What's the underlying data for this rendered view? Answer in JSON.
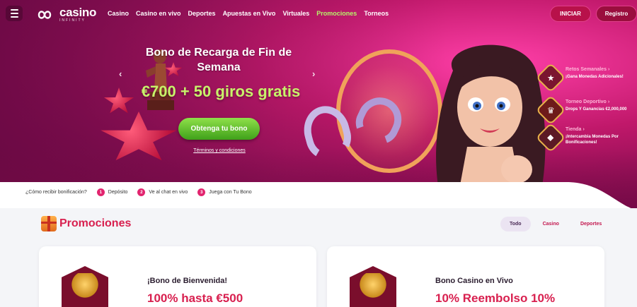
{
  "nav": {
    "logo_main": "casino",
    "logo_sub": "INFINITY",
    "links": [
      {
        "label": "Casino"
      },
      {
        "label": "Casino en vivo"
      },
      {
        "label": "Deportes"
      },
      {
        "label": "Apuestas en Vivo"
      },
      {
        "label": "Virtuales"
      },
      {
        "label": "Promociones"
      },
      {
        "label": "Torneos"
      }
    ],
    "active_link": "Promociones",
    "login_label": "INICIAR",
    "register_label": "Registro"
  },
  "banner": {
    "title": "Bono de Recarga de Fin de Semana",
    "offer": "€700 + 50 giros gratis",
    "cta_label": "Obtenga tu bono",
    "terms_label": "Términos y condiciones",
    "prev_icon": "chevron-left-icon",
    "next_icon": "chevron-right-icon"
  },
  "side_promos": [
    {
      "title": "Retos Semanales",
      "subtitle": "¡Gana Monedas Adicionales!",
      "icon": "star-badge-icon"
    },
    {
      "title": "Torneo Deportivo",
      "subtitle": "Drops Y Ganancias €2,000,000",
      "icon": "trophy-badge-icon"
    },
    {
      "title": "Tienda",
      "subtitle": "¡Intercambia Monedas Por Bonificaciones!",
      "icon": "shop-badge-icon"
    }
  ],
  "steps": {
    "question": "¿Cómo recibir bonificación?",
    "items": [
      {
        "num": "1",
        "label": "Depósito"
      },
      {
        "num": "2",
        "label": "Ve al chat en vivo"
      },
      {
        "num": "3",
        "label": "Juega con Tu Bono"
      }
    ]
  },
  "promotions": {
    "title": "Promociones",
    "tabs": [
      {
        "label": "Todo"
      },
      {
        "label": "Casino"
      },
      {
        "label": "Deportes"
      }
    ],
    "active_tab": "Todo",
    "cards": [
      {
        "subtitle": "¡Bono de Bienvenida!",
        "headline": "100% hasta €500",
        "icon": "winged-lion-icon"
      },
      {
        "subtitle": "Bono Casino en Vivo",
        "headline": "10% Reembolso 10%",
        "icon": "golden-statue-icon"
      }
    ]
  },
  "colors": {
    "accent_pink": "#d8204f",
    "offer_green": "#c7f26a",
    "cta_green": "#5cc12a",
    "hero_magenta": "#c0186a"
  }
}
